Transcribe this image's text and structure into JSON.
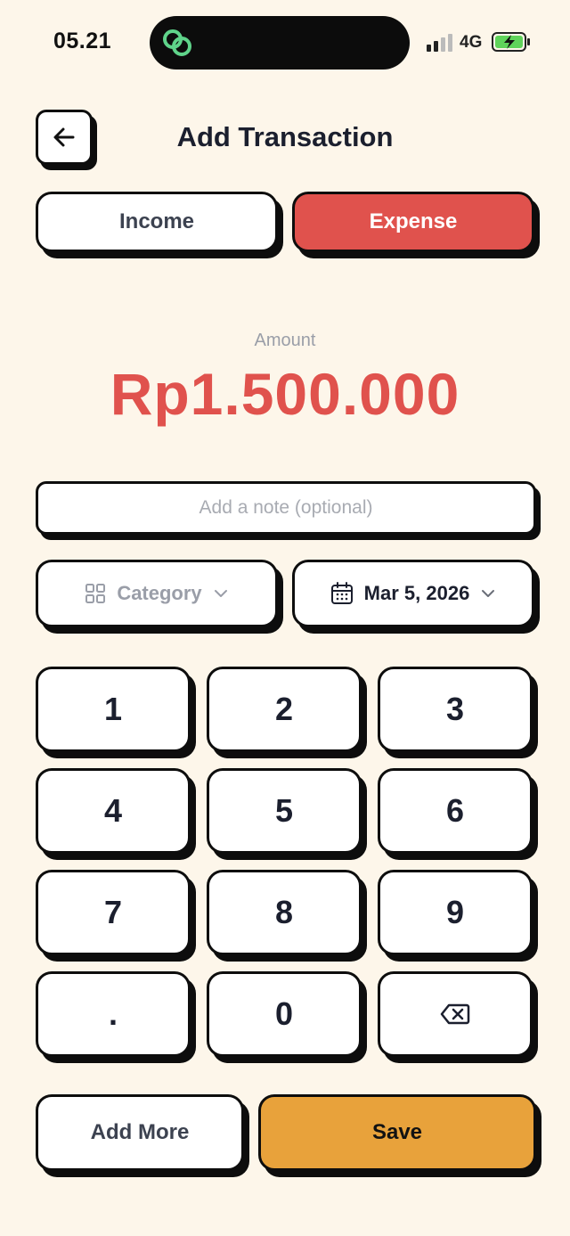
{
  "status_bar": {
    "time": "05.21",
    "network": "4G",
    "island_icon": "link-rings-icon",
    "battery": "battery-charging-icon"
  },
  "header": {
    "title": "Add Transaction",
    "back_icon": "arrow-left-icon"
  },
  "type_toggle": {
    "income_label": "Income",
    "expense_label": "Expense",
    "selected": "Expense"
  },
  "amount": {
    "label": "Amount",
    "value": "Rp1.500.000"
  },
  "note": {
    "value": "",
    "placeholder": "Add a note (optional)"
  },
  "category": {
    "label": "Category",
    "icon": "grid-icon"
  },
  "date": {
    "label": "Mar 5, 2026",
    "icon": "calendar-icon"
  },
  "keypad": {
    "keys": [
      "1",
      "2",
      "3",
      "4",
      "5",
      "6",
      "7",
      "8",
      "9",
      ".",
      "0"
    ],
    "backspace_icon": "backspace-icon"
  },
  "actions": {
    "add_more_label": "Add More",
    "save_label": "Save"
  },
  "colors": {
    "background": "#fdf6ea",
    "expense": "#e0524d",
    "save": "#e8a23b",
    "text": "#1b1f2e",
    "muted": "#9a9ea8"
  }
}
